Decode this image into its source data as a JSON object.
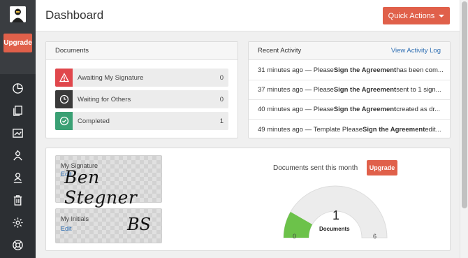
{
  "header": {
    "title": "Dashboard",
    "quick_actions": "Quick Actions"
  },
  "sidebar": {
    "upgrade": "Upgrade",
    "items": [
      {
        "icon": "dashboard-icon"
      },
      {
        "icon": "documents-icon"
      },
      {
        "icon": "templates-icon"
      },
      {
        "icon": "contacts-icon"
      },
      {
        "icon": "signing-icon"
      },
      {
        "icon": "trash-icon"
      },
      {
        "icon": "settings-icon"
      },
      {
        "icon": "help-icon"
      }
    ]
  },
  "documents": {
    "title": "Documents",
    "rows": [
      {
        "label": "Awaiting My Signature",
        "count": "0",
        "color": "#e0474c"
      },
      {
        "label": "Waiting for Others",
        "count": "0",
        "color": "#3a3a3a"
      },
      {
        "label": "Completed",
        "count": "1",
        "color": "#3aa074"
      }
    ]
  },
  "activity": {
    "title": "Recent Activity",
    "link": "View Activity Log",
    "rows": [
      {
        "time": "31 minutes ago",
        "prefix": "Please ",
        "bold": "Sign the Agreement",
        "suffix": " has been com..."
      },
      {
        "time": "37 minutes ago",
        "prefix": "Please ",
        "bold": "Sign the Agreement",
        "suffix": " sent to 1 sign..."
      },
      {
        "time": "40 minutes ago",
        "prefix": "Please ",
        "bold": "Sign the Agreement",
        "suffix": " created as dr..."
      },
      {
        "time": "49 minutes ago",
        "prefix": "Template Please ",
        "bold": "Sign the Agreement",
        "suffix": " edit..."
      }
    ]
  },
  "signature": {
    "sig_label": "My Signature",
    "sig_edit": "Edit",
    "sig_text": "Ben Stegner",
    "init_label": "My Initials",
    "init_edit": "Edit",
    "init_text": "BS"
  },
  "usage": {
    "title": "Documents sent this month",
    "upgrade": "Upgrade",
    "value": "1",
    "label": "Documents",
    "min": "0",
    "max": "6",
    "used": 1,
    "limit": 6,
    "fill_color": "#6cc24a"
  }
}
